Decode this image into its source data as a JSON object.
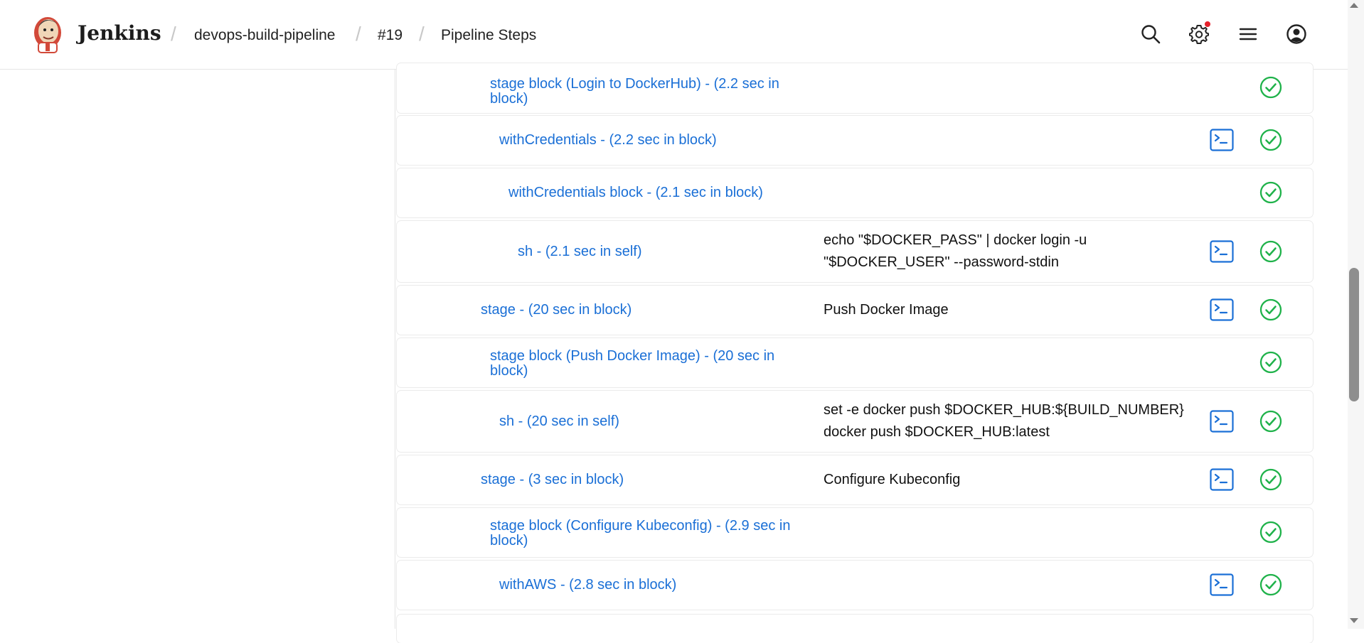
{
  "header": {
    "brand": "Jenkins",
    "breadcrumbs": [
      "devops-build-pipeline",
      "#19",
      "Pipeline Steps"
    ],
    "icons": [
      "search-icon",
      "gear-icon",
      "menu-icon",
      "user-icon"
    ],
    "notification_color": "#e5212b"
  },
  "colors": {
    "link": "#1a6fd6",
    "success": "#1fb24a",
    "console": "#1a6fd6"
  },
  "steps": [
    {
      "label": "stage block (Login to DockerHub) - (2.2 sec in block)",
      "args": "",
      "console": false,
      "status": "success"
    },
    {
      "label": "withCredentials - (2.2 sec in block)",
      "args": "",
      "console": true,
      "status": "success"
    },
    {
      "label": "withCredentials block - (2.1 sec in block)",
      "args": "",
      "console": false,
      "status": "success"
    },
    {
      "label": "sh - (2.1 sec in self)",
      "args": "echo \"$DOCKER_PASS\" | docker login -u \"$DOCKER_USER\" --password-stdin",
      "console": true,
      "status": "success"
    },
    {
      "label": "stage - (20 sec in block)",
      "args": "Push Docker Image",
      "console": true,
      "status": "success"
    },
    {
      "label": "stage block (Push Docker Image) - (20 sec in block)",
      "args": "",
      "console": false,
      "status": "success"
    },
    {
      "label": "sh - (20 sec in self)",
      "args": "set -e docker push $DOCKER_HUB:${BUILD_NUMBER} docker push $DOCKER_HUB:latest",
      "console": true,
      "status": "success"
    },
    {
      "label": "stage - (3 sec in block)",
      "args": "Configure Kubeconfig",
      "console": true,
      "status": "success"
    },
    {
      "label": "stage block (Configure Kubeconfig) - (2.9 sec in block)",
      "args": "",
      "console": false,
      "status": "success"
    },
    {
      "label": "withAWS - (2.8 sec in block)",
      "args": "",
      "console": true,
      "status": "success"
    }
  ]
}
